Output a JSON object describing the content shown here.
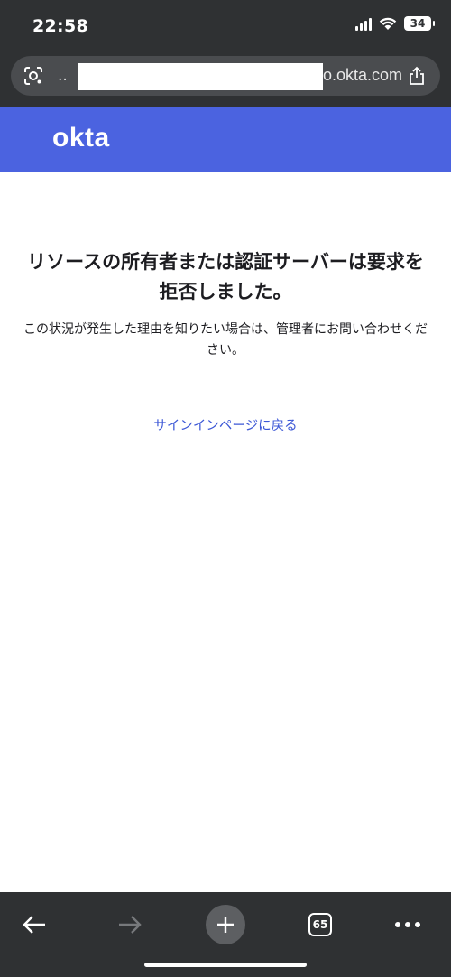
{
  "status_bar": {
    "time": "22:58",
    "battery": "34"
  },
  "browser": {
    "url_prefix": "..",
    "url_domain": "o.okta.com",
    "tab_count": "65"
  },
  "brand": {
    "logo_text": "okta",
    "color": "#4b63e0"
  },
  "content": {
    "title": "リソースの所有者または認証サーバーは要求を拒否しました。",
    "description": "この状況が発生した理由を知りたい場合は、管理者にお問い合わせください。",
    "back_link": "サインインページに戻る"
  },
  "colors": {
    "chrome": "#2f3133",
    "link": "#3c57d6"
  }
}
